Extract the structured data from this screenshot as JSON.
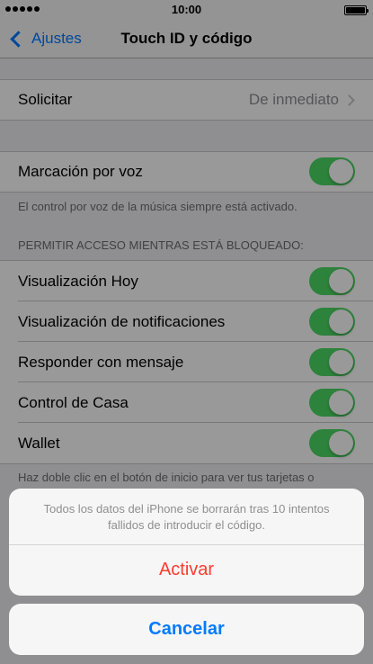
{
  "status_bar": {
    "time": "10:00"
  },
  "nav": {
    "back_label": "Ajustes",
    "title": "Touch ID y código"
  },
  "request": {
    "label": "Solicitar",
    "value": "De inmediato"
  },
  "voice": {
    "label": "Marcación por voz",
    "footer": "El control por voz de la música siempre está activado."
  },
  "locked_access": {
    "header": "PERMITIR ACCESO MIENTRAS ESTÁ BLOQUEADO:",
    "items": [
      {
        "label": "Visualización Hoy"
      },
      {
        "label": "Visualización de notificaciones"
      },
      {
        "label": "Responder con mensaje"
      },
      {
        "label": "Control de Casa"
      },
      {
        "label": "Wallet"
      }
    ],
    "footer": "Haz doble clic en el botón de inicio para ver tus tarjetas o"
  },
  "action_sheet": {
    "message": "Todos los datos del iPhone se borrarán tras 10 intentos fallidos de introducir el código.",
    "activate_label": "Activar",
    "cancel_label": "Cancelar"
  },
  "colors": {
    "accent": "#007aff",
    "toggle_on": "#4cd964",
    "destructive": "#ff3b30"
  }
}
